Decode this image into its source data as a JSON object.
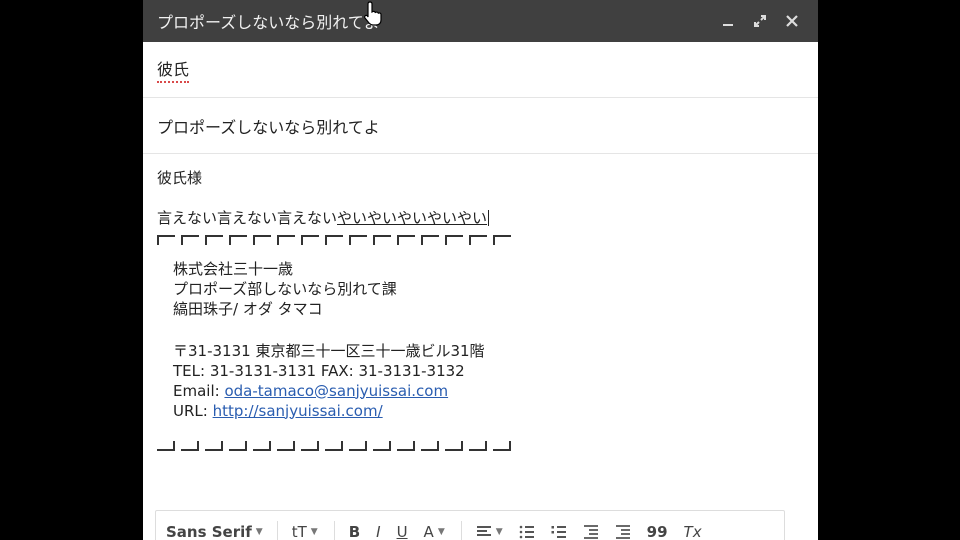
{
  "compose": {
    "title": "プロポーズしないなら別れてよ",
    "controls": {
      "minimize": "minimize-icon",
      "expand": "expand-icon",
      "close": "close-icon"
    },
    "to": "彼氏",
    "subject": "プロポーズしないなら別れてよ",
    "body": {
      "greeting": "彼氏様",
      "lead_plain": "言えない言えない言えない",
      "lead_underlined": "やいやいやいやいやい",
      "signature": {
        "company": "株式会社三十一歳",
        "department": "プロポーズ部しないなら別れて課",
        "name": "縞田珠子/ オダ タマコ",
        "address": "〒31-3131 東京都三十一区三十一歳ビル31階",
        "phone_line": "TEL: 31-3131-3131 FAX: 31-3131-3132",
        "email_label": "Email:",
        "email": "oda-tamaco@sanjyuissai.com",
        "url_label": "URL:",
        "url": "http://sanjyuissai.com/"
      }
    }
  },
  "toolbar": {
    "font": "Sans Serif",
    "size_icon": "tT",
    "bold": "B",
    "italic": "I",
    "underline": "U",
    "text_color": "A",
    "align_icon": "align-icon",
    "numbered_list_icon": "numbered-list-icon",
    "bulleted_list_icon": "bulleted-list-icon",
    "indent_less_icon": "indent-less-icon",
    "indent_more_icon": "indent-more-icon",
    "quote": "99",
    "clear_format": "Tx"
  },
  "colors": {
    "titlebar": "#404040",
    "link": "#2a5db0",
    "spell_underline": "#d94a4a"
  }
}
